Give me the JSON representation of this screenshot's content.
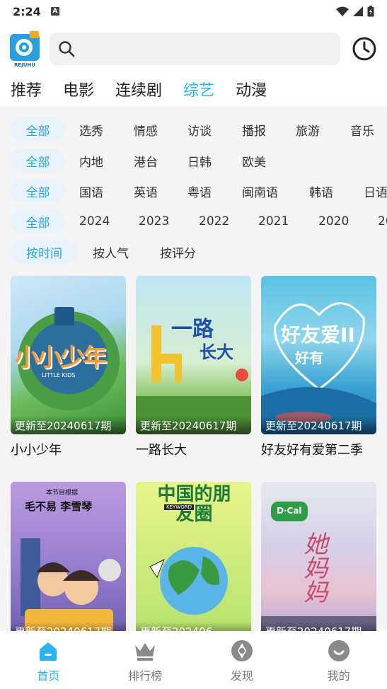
{
  "status": {
    "time": "2:24",
    "notif_badge": "A"
  },
  "logo_text": "REJUHU",
  "search": {
    "placeholder": ""
  },
  "categories": [
    {
      "label": "推荐"
    },
    {
      "label": "电影"
    },
    {
      "label": "连续剧"
    },
    {
      "label": "综艺",
      "active": true
    },
    {
      "label": "动漫"
    }
  ],
  "filters": {
    "type": {
      "selected": "全部",
      "items": [
        "选秀",
        "情感",
        "访谈",
        "播报",
        "旅游",
        "音乐"
      ]
    },
    "region": {
      "selected": "全部",
      "items": [
        "内地",
        "港台",
        "日韩",
        "欧美"
      ]
    },
    "language": {
      "selected": "全部",
      "items": [
        "国语",
        "英语",
        "粤语",
        "闽南语",
        "韩语",
        "日语"
      ]
    },
    "year": {
      "selected": "全部",
      "items": [
        "2024",
        "2023",
        "2022",
        "2021",
        "2020",
        "20"
      ]
    },
    "sort": {
      "selected": "按时间",
      "items": [
        "按人气",
        "按评分"
      ]
    }
  },
  "cards": [
    {
      "title": "小小少年",
      "update": "更新至20240617期",
      "poster_text": "小小少年",
      "poster_sub": "LITTLE KIDS"
    },
    {
      "title": "一路长大",
      "update": "更新至20240617期",
      "poster_text": "一路",
      "poster_sub": "长大"
    },
    {
      "title": "好友好有爱第二季",
      "update": "更新至20240617期",
      "poster_text": "好友爱II",
      "poster_sub": "好有"
    },
    {
      "title": "",
      "update": "更新至20240617期",
      "poster_text": "毛不易 李雪琴",
      "poster_sub": "本节目根据"
    },
    {
      "title": "",
      "update": "更新至202406",
      "poster_text": "中国的朋友圈",
      "poster_sub": "KEYWORD"
    },
    {
      "title": "",
      "update": "更新至20240617期",
      "poster_text": "她妈妈",
      "poster_sub": "D·Cal"
    }
  ],
  "tabs": [
    {
      "label": "首页",
      "icon": "home-icon",
      "active": true
    },
    {
      "label": "排行榜",
      "icon": "crown-icon"
    },
    {
      "label": "发现",
      "icon": "aperture-icon"
    },
    {
      "label": "我的",
      "icon": "smile-icon"
    }
  ],
  "colors": {
    "accent": "#29b4ec",
    "pill_bg": "#e9f3fb",
    "filter_bg": "#f5f5f5"
  }
}
